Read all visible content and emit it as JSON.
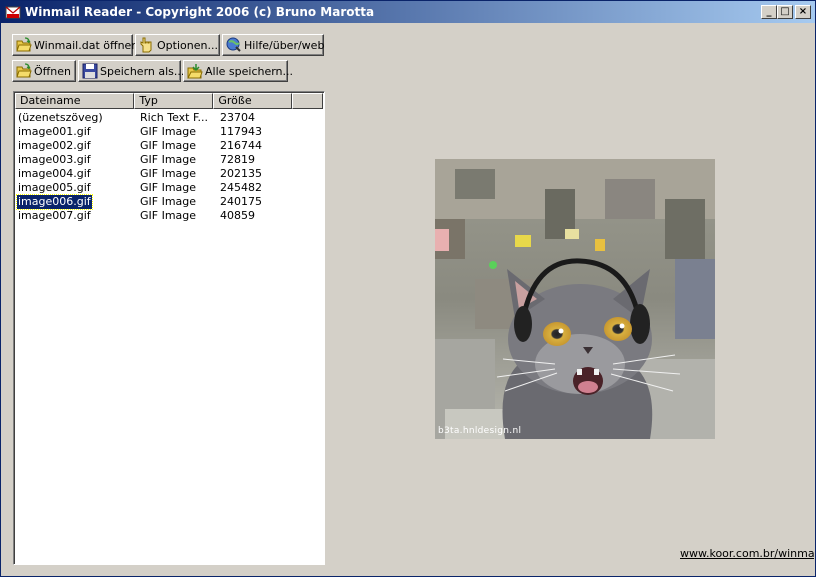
{
  "window": {
    "title": "Winmail Reader - Copyright 2006 (c) Bruno Marotta",
    "controls": {
      "minimize": "_",
      "maximize": "□",
      "close": "×"
    }
  },
  "toolbar": {
    "row1": [
      {
        "label": "Winmail.dat öffnen",
        "icon": "open-folder-icon"
      },
      {
        "label": "Optionen...",
        "icon": "options-hand-icon"
      },
      {
        "label": "Hilfe/über/web",
        "icon": "help-globe-icon"
      }
    ],
    "row2": [
      {
        "label": "Öffnen",
        "icon": "open-folder-icon"
      },
      {
        "label": "Speichern als...",
        "icon": "floppy-disk-icon"
      },
      {
        "label": "Alle speichern...",
        "icon": "save-all-icon"
      }
    ]
  },
  "filelist": {
    "columns": [
      "Dateiname",
      "Typ",
      "Größe"
    ],
    "rows": [
      {
        "name": "(üzenetszöveg)",
        "type": "Rich Text F...",
        "size": "23704"
      },
      {
        "name": "image001.gif",
        "type": "GIF Image",
        "size": "117943"
      },
      {
        "name": "image002.gif",
        "type": "GIF Image",
        "size": "216744"
      },
      {
        "name": "image003.gif",
        "type": "GIF Image",
        "size": "72819"
      },
      {
        "name": "image004.gif",
        "type": "GIF Image",
        "size": "202135"
      },
      {
        "name": "image005.gif",
        "type": "GIF Image",
        "size": "245482"
      },
      {
        "name": "image006.gif",
        "type": "GIF Image",
        "size": "240175",
        "selected": true
      },
      {
        "name": "image007.gif",
        "type": "GIF Image",
        "size": "40859"
      }
    ]
  },
  "preview": {
    "watermark": "b3ta.hnldesign.nl"
  },
  "footer": {
    "link": "www.koor.com.br/winmail/d"
  },
  "colors": {
    "titlebar_start": "#0a246a",
    "titlebar_end": "#a6caf0",
    "selection": "#0a246a",
    "face": "#d4d0c8"
  }
}
